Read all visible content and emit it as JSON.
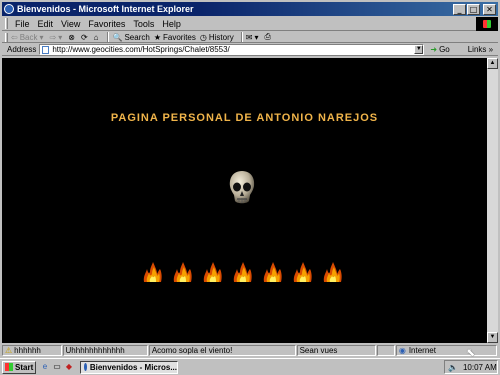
{
  "window": {
    "title": "Bienvenidos - Microsoft Internet Explorer"
  },
  "menu": [
    "File",
    "Edit",
    "View",
    "Favorites",
    "Tools",
    "Help"
  ],
  "toolbar": {
    "back": "Back",
    "search": "Search",
    "favorites": "Favorites",
    "history": "History"
  },
  "address": {
    "label": "Address",
    "url": "http://www.geocities.com/HotSprings/Chalet/8553/",
    "go": "Go",
    "links": "Links"
  },
  "page": {
    "heading": "PAGINA PERSONAL DE ANTONIO NAREJOS",
    "heading_color": "#f0b44a",
    "background": "#000000",
    "flame_count": 7
  },
  "status": {
    "panes": [
      "hhhhhh",
      "Uhhhhhhhhhhhh",
      "Acomo sopla el viento!",
      "Sean vues",
      "Internet"
    ]
  },
  "taskbar": {
    "start": "Start",
    "task": "Bienvenidos - Micros...",
    "clock": "10:07 AM"
  }
}
